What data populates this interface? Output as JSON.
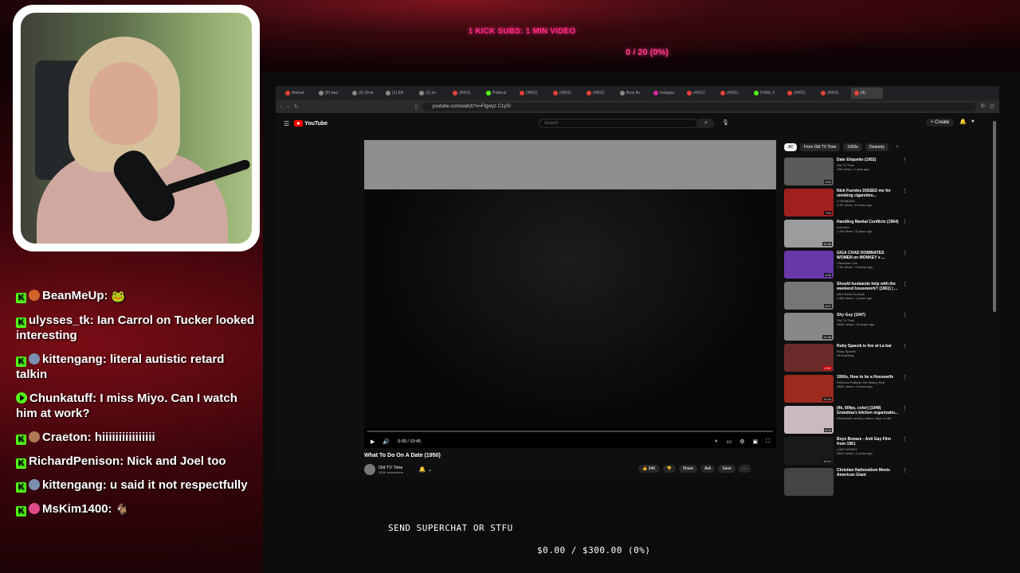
{
  "overlay": {
    "kick_goal_text": "1 KICK SUBS: 1 MIN VIDEO",
    "goal_progress": "0 / 20 (0%)",
    "superchat_text": "SEND SUPERCHAT OR STFU",
    "money_progress": "$0.00 / $300.00 (0%)"
  },
  "chat": {
    "messages": [
      {
        "user": "BeanMeUp:",
        "text": "",
        "emote": "🐸"
      },
      {
        "user": "ulysses_tk:",
        "text": "Ian Carrol on Tucker looked interesting"
      },
      {
        "user": "kittengang:",
        "text": "literal autistic retard talkin"
      },
      {
        "user": "Chunkatuff:",
        "text": "I miss Miyo. Can I watch him at work?"
      },
      {
        "user": "Craeton:",
        "text": "hiiiiiiiiiiiiiiii"
      },
      {
        "user": "RichardPenison:",
        "text": "Nick and Joel too"
      },
      {
        "user": "kittengang:",
        "text": "u said it not respectfully"
      },
      {
        "user": "MsKim1400:",
        "text": "",
        "emote": "🐐"
      }
    ]
  },
  "browser": {
    "tabs": [
      {
        "label": "Animal",
        "color": "#e5423a"
      },
      {
        "label": "(9) true",
        "color": "#888"
      },
      {
        "label": "(9) Grok",
        "color": "#888"
      },
      {
        "label": "(1) Elli",
        "color": "#888"
      },
      {
        "label": "(1) on",
        "color": "#888"
      },
      {
        "label": "(4001)",
        "color": "#e5423a"
      },
      {
        "label": "Political",
        "color": "#53fc18"
      },
      {
        "label": "(4001)",
        "color": "#e5423a"
      },
      {
        "label": "(4001)",
        "color": "#e5423a"
      },
      {
        "label": "(4001)",
        "color": "#e5423a"
      },
      {
        "label": "Bros fle",
        "color": "#888"
      },
      {
        "label": "Instagra",
        "color": "#d6249f"
      },
      {
        "label": "(4001)",
        "color": "#e5423a"
      },
      {
        "label": "(4001)",
        "color": "#e5423a"
      },
      {
        "label": "FINAL 3",
        "color": "#53fc18"
      },
      {
        "label": "(4001)",
        "color": "#e5423a"
      },
      {
        "label": "(4001)",
        "color": "#e5423a"
      },
      {
        "label": "(4)",
        "color": "#e5423a"
      }
    ],
    "url": "youtube.com/watch?v=Ftgwyz C1ySI"
  },
  "youtube": {
    "logo_text": "YouTube",
    "search_placeholder": "Search",
    "create_label": "+ Create",
    "video_time": "0:00 / 10:45",
    "video_title": "What To Do On A Date (1950)",
    "channel_name": "Old TV Time",
    "channel_subs": "309K subscribers",
    "actions": {
      "like": "👍 34K",
      "share": "Share",
      "ask": "Ask",
      "save": "Save"
    },
    "chips": [
      "All",
      "From Old TV Time",
      "1950s",
      "Dearedy"
    ],
    "recommendations": [
      {
        "title": "Date Etiquette (1952)",
        "channel": "Old TV Time",
        "meta": "29K views • 1 year ago",
        "duration": "9:53",
        "thumb": "#5b5b5b"
      },
      {
        "title": "Nick Fuentes DISSED me for smoking cigarettes...",
        "channel": "LITEMBARD",
        "meta": "3.1K views • 5 hours ago",
        "duration": "7:54",
        "thumb": "#a0201f"
      },
      {
        "title": "Handling Marital Conflicts (1964)",
        "channel": "tvarchive",
        "meta": "1.2M views • 8 years ago",
        "duration": "10:06",
        "thumb": "#9c9c9c"
      },
      {
        "title": "GIGA CHAD DOMINATES WOMEN on MONKEY x ...",
        "channel": "Clavicular Live",
        "meta": "7.5K views • 3 weeks ago",
        "duration": "4:52",
        "thumb": "#6a39a8"
      },
      {
        "title": "Should husbands help with the weekend housework? (1961) | ...",
        "channel": "ABC News In-depth",
        "meta": "4.5M views • 2 years ago",
        "duration": "8:57",
        "thumb": "#767676"
      },
      {
        "title": "Shy Guy (1947)",
        "channel": "Old TV Time",
        "meta": "466K views • 13 years ago",
        "duration": "13:36",
        "thumb": "#888888"
      },
      {
        "title": "Ruby Spacek is live at La bar",
        "channel": "Ruby Spacek",
        "meta": "28 watching",
        "duration": "LIVE",
        "thumb": "#6b2a2a"
      },
      {
        "title": "1950s, How to be a Housewife",
        "channel": "Rebecca Pattison the History Buff",
        "meta": "486K views • 3 years ago",
        "duration": "11:24",
        "thumb": "#9c2a1e"
      },
      {
        "title": "[4k, 60fps, color] (1949) Grandma's kitchen organizatio...",
        "channel": "Nineteenth century videos. Back to life",
        "meta": "",
        "duration": "8:34",
        "thumb": "#c9b9c0"
      },
      {
        "title": "Boys Beware - Anti Gay Film from 1961",
        "channel": "LGBT MONEY",
        "meta": "281K views • 3 years ago",
        "duration": "10:13",
        "thumb": "#1a1a1a"
      },
      {
        "title": "Christian Nationalism Meets American Giant",
        "channel": "",
        "meta": "",
        "duration": "",
        "thumb": "#444444"
      }
    ]
  },
  "colors": {
    "kick_green": "#53fc18",
    "goal_pink": "#ff2a84",
    "youtube_red": "#ff0000"
  }
}
